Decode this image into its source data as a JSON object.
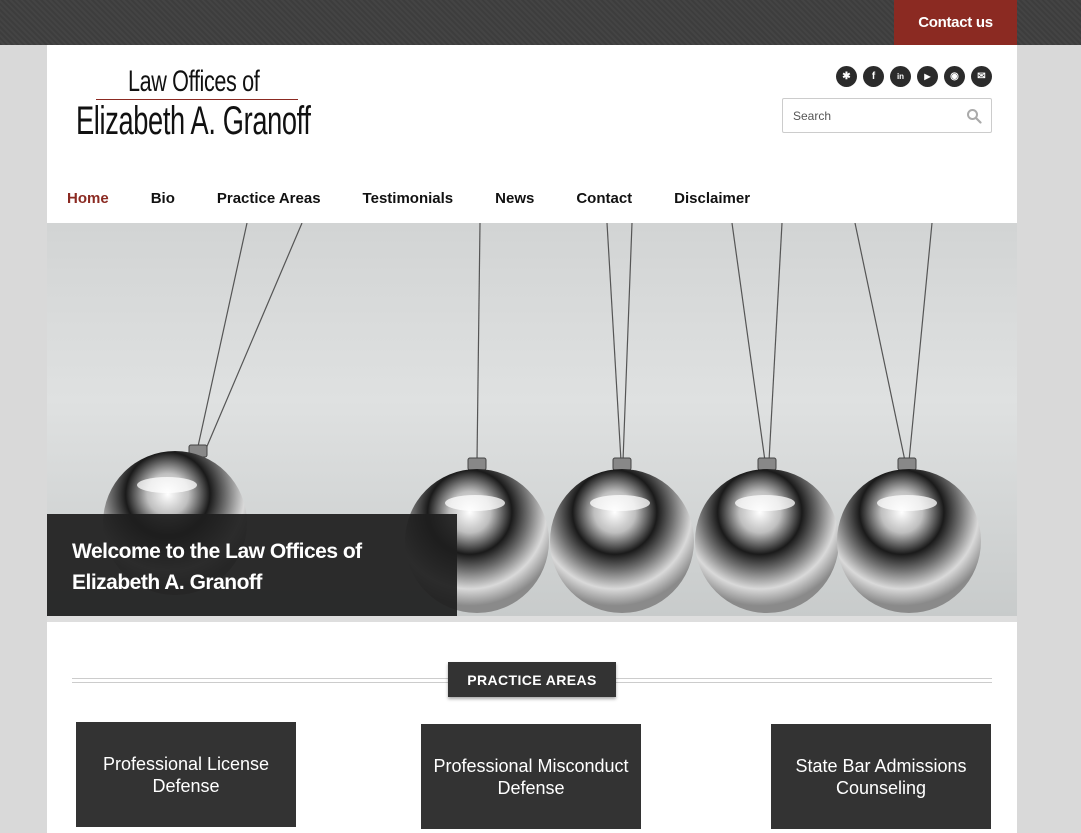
{
  "topbar": {
    "contact_label": "Contact us"
  },
  "logo": {
    "line1": "Law Offices of",
    "line2": "Elizabeth A. Granoff"
  },
  "social": [
    {
      "name": "yelp-icon",
      "glyph": "✱"
    },
    {
      "name": "facebook-icon",
      "glyph": "f"
    },
    {
      "name": "linkedin-icon",
      "glyph": "in"
    },
    {
      "name": "youtube-icon",
      "glyph": "▶"
    },
    {
      "name": "rss-icon",
      "glyph": "◉"
    },
    {
      "name": "email-icon",
      "glyph": "✉"
    }
  ],
  "search": {
    "placeholder": "Search"
  },
  "nav": {
    "home": "Home",
    "bio": "Bio",
    "practice_areas": "Practice Areas",
    "testimonials": "Testimonials",
    "news": "News",
    "contact": "Contact",
    "disclaimer": "Disclaimer"
  },
  "hero": {
    "caption": "Welcome to the Law Offices of Elizabeth A. Granoff"
  },
  "practice": {
    "heading": "PRACTICE AREAS",
    "cards": [
      "Professional License Defense",
      "Professional Misconduct Defense",
      "State Bar Admissions Counseling"
    ]
  },
  "colors": {
    "accent": "#8b2a22",
    "dark": "#333333",
    "topbar": "#404040"
  }
}
